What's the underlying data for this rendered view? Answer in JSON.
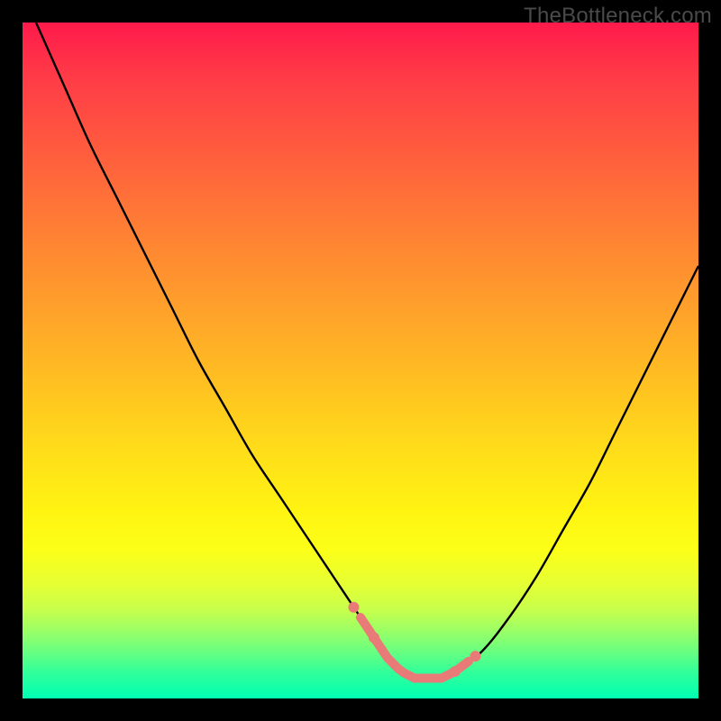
{
  "watermark": "TheBottleneck.com",
  "colors": {
    "background": "#000000",
    "gradient_top": "#ff1a4b",
    "gradient_bottom": "#00ffb3",
    "curve": "#000000",
    "markers": "#e87a78"
  },
  "chart_data": {
    "type": "line",
    "title": "",
    "xlabel": "",
    "ylabel": "",
    "xlim": [
      0,
      100
    ],
    "ylim": [
      0,
      100
    ],
    "series": [
      {
        "name": "bottleneck-curve",
        "x": [
          2,
          6,
          10,
          14,
          18,
          22,
          26,
          30,
          34,
          38,
          42,
          46,
          50,
          52,
          54,
          56,
          58,
          60,
          62,
          64,
          68,
          72,
          76,
          80,
          84,
          88,
          92,
          96,
          100
        ],
        "values": [
          100,
          91,
          82,
          74,
          66,
          58,
          50,
          43,
          36,
          30,
          24,
          18,
          12,
          9,
          6,
          4,
          3,
          3,
          3,
          4,
          7,
          12,
          18,
          25,
          32,
          40,
          48,
          56,
          64
        ]
      }
    ],
    "highlight_region": {
      "x_start": 50,
      "x_end": 66
    },
    "annotations": []
  }
}
